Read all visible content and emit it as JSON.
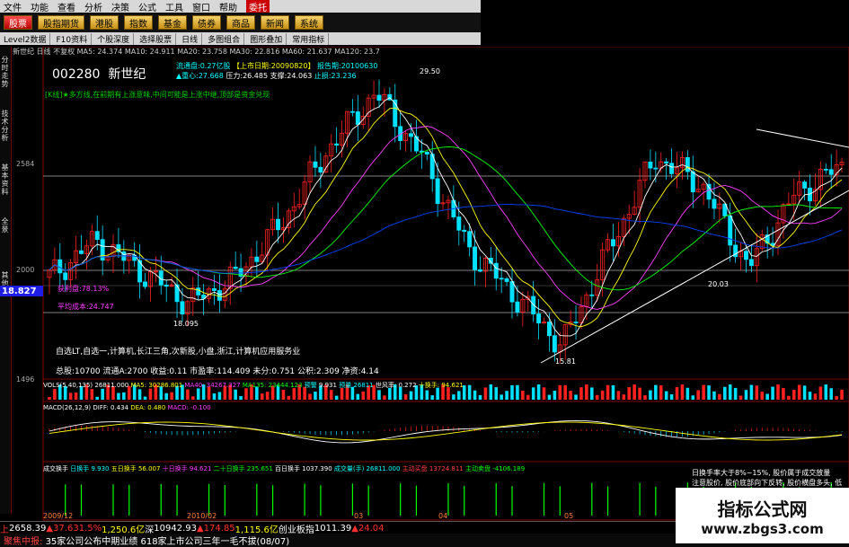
{
  "menu": [
    "文件",
    "功能",
    "查看",
    "分析",
    "决策",
    "公式",
    "工具",
    "窗口",
    "帮助",
    "委托"
  ],
  "toolbar": [
    "股票",
    "股指期货",
    "港股",
    "指数",
    "基金",
    "债券",
    "商品",
    "新闻",
    "系统"
  ],
  "subbar": [
    "Level2数据",
    "F10资料",
    "个股深度",
    "选择股票",
    "日线",
    "多图组合",
    "图形叠加",
    "常用指标"
  ],
  "vtabs": [
    "分时走势",
    "技术分析",
    "基本资料",
    "全景",
    "其他"
  ],
  "info_head": "新世纪  日线  不复权  MA5: 24.374  MA10: 24.911  MA20: 23.758  MA30: 22.816  MA60: 21.637  MA120: 23.7",
  "stock": {
    "code": "002280",
    "name": "新世纪"
  },
  "info_lines": [
    [
      {
        "t": "流通盘:0.27亿股",
        "c": "c"
      },
      {
        "t": " 【上市日期:20090820】",
        "c": "y"
      },
      {
        "t": " 报告期:20100630",
        "c": "c"
      }
    ],
    [
      {
        "t": "▲重心:27.668",
        "c": "c"
      },
      {
        "t": " 压力:26.485 支撑:24.063",
        "c": "w"
      },
      {
        "t": " 止损:23.236",
        "c": "c"
      }
    ]
  ],
  "comment": "[K线]★多方线,在前期有上涨意味,中间可能是上涨中继,顶部是资金兑现",
  "price_labels": {
    "top": "2584",
    "mid": "2000",
    "bottom": "1496"
  },
  "price_notes": {
    "high": "29.50",
    "low1": "18.095",
    "low2": "15.81",
    "mid": "20.03",
    "avg1": "获利盘:78.13%",
    "avg2": "平均成本:24.747"
  },
  "cursor_price": "18.827",
  "concept": "自选LT,自选一,计算机,长江三角,次新股,小盘,浙江,计算机应用服务业",
  "finance": "总股:10700 流通A:2700 收益:0.11 市盈率:114.409 未分:0.751 公积:2.309 净资:4.14",
  "vol_head": [
    {
      "t": "VOLS(5,40,135)",
      "c": "w"
    },
    {
      "t": " 26811.000",
      "c": "w"
    },
    {
      "t": " MA5: 30286.801",
      "c": "y"
    },
    {
      "t": " MA40: 34267.327",
      "c": "m"
    },
    {
      "t": " MA135: 23444.123",
      "c": "g"
    },
    {
      "t": " 预警",
      "c": "c"
    },
    {
      "t": " 9.931",
      "c": "w"
    },
    {
      "t": "   预量 26811",
      "c": "c"
    },
    {
      "t": "   世风率: 0.272",
      "c": "w"
    },
    {
      "t": "   十换手: 94.621",
      "c": "y"
    }
  ],
  "macd_head": [
    {
      "t": "MACD(26,12,9)",
      "c": "w"
    },
    {
      "t": " DIFF: 0.434",
      "c": "w"
    },
    {
      "t": " DEA: 0.480",
      "c": "y"
    },
    {
      "t": " MACD: -0.100",
      "c": "m"
    }
  ],
  "bottom_head": [
    {
      "t": "成交换手",
      "c": "w"
    },
    {
      "t": " 日换手 9.930",
      "c": "c"
    },
    {
      "t": " 五日换手 56.007",
      "c": "y"
    },
    {
      "t": " 十日换手 94.621",
      "c": "m"
    },
    {
      "t": " 二十日换手 235.651",
      "c": "g"
    },
    {
      "t": " 百日换手 1037.390",
      "c": "w"
    },
    {
      "t": " 成交量(手) 26811.000",
      "c": "c"
    },
    {
      "t": " 主动买盘 13724.811",
      "c": "r"
    },
    {
      "t": " 主动卖盘 -4106.189",
      "c": "g"
    }
  ],
  "tips": [
    "日换手率大于8%~15%, 股价属于成交放量",
    "注意股价, 股价底部向下反转, 股价横盘多头, 低位向上反转"
  ],
  "dates": [
    "2009/12",
    "2010/02",
    "03",
    "04",
    "05"
  ],
  "status": [
    {
      "t": "上",
      "c": "r"
    },
    {
      "t": " 2658.39 ",
      "c": "w"
    },
    {
      "t": " ▲37.63",
      "c": "r"
    },
    {
      "t": "  1.5%",
      "c": "r"
    },
    {
      "t": "  1,250.6亿",
      "c": "y"
    },
    {
      "t": "  深",
      "c": "w"
    },
    {
      "t": "  10942.93",
      "c": "w"
    },
    {
      "t": "  ▲174.85",
      "c": "r"
    },
    {
      "t": "  1,115.6亿",
      "c": "y"
    },
    {
      "t": "  创业板指",
      "c": "w"
    },
    {
      "t": "  1011.39",
      "c": "w"
    },
    {
      "t": "  ▲24.04",
      "c": "r"
    }
  ],
  "news": [
    "聚焦中报:",
    "35家公司公布中期业绩 618家上市公司三年一毛不拔(08/07)"
  ],
  "watermark": {
    "line1": "指标公式网",
    "line2": "www.zbgs3.com"
  },
  "colors": {
    "up": "#ff2020",
    "down": "#00e0ff",
    "ma5": "#ffffff",
    "ma10": "#ffff00",
    "ma20": "#ff40ff",
    "ma30": "#00ff00",
    "ma60": "#0040ff"
  },
  "chart_data": {
    "type": "candlestick",
    "title": "002280 新世纪",
    "ylabel": "",
    "ohlc_trend": [
      {
        "d": "2009/12",
        "close": 19.5
      },
      {
        "d": "2010/01",
        "close": 21.5
      },
      {
        "d": "2010/01b",
        "close": 19.8
      },
      {
        "d": "2010/02",
        "close": 18.1
      },
      {
        "d": "2010/02b",
        "close": 19.5
      },
      {
        "d": "2010/03",
        "close": 22.5
      },
      {
        "d": "2010/03b",
        "close": 26.5
      },
      {
        "d": "2010/03c",
        "close": 29.5
      },
      {
        "d": "2010/04",
        "close": 26.0
      },
      {
        "d": "2010/04b",
        "close": 21.0
      },
      {
        "d": "2010/04c",
        "close": 18.5
      },
      {
        "d": "2010/05",
        "close": 15.81
      },
      {
        "d": "2010/05b",
        "close": 21.0
      },
      {
        "d": "2010/06",
        "close": 26.0
      },
      {
        "d": "2010/06b",
        "close": 24.5
      },
      {
        "d": "2010/07",
        "close": 20.03
      },
      {
        "d": "2010/07b",
        "close": 24.0
      },
      {
        "d": "2010/08",
        "close": 25.5
      }
    ]
  }
}
